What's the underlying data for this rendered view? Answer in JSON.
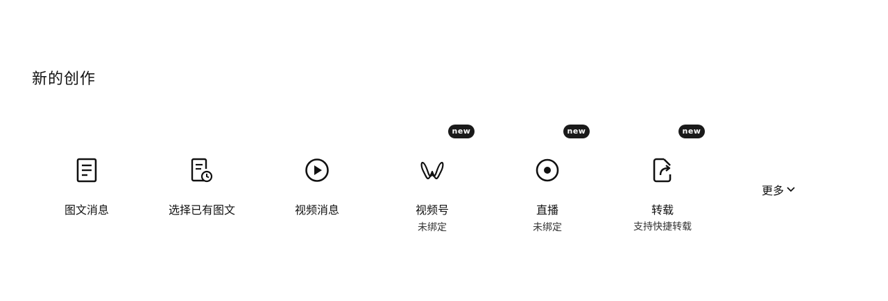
{
  "section": {
    "title": "新的创作"
  },
  "items": [
    {
      "label": "图文消息",
      "sub": "",
      "badge": "",
      "icon": "document-icon"
    },
    {
      "label": "选择已有图文",
      "sub": "",
      "badge": "",
      "icon": "document-clock-icon"
    },
    {
      "label": "视频消息",
      "sub": "",
      "badge": "",
      "icon": "play-circle-icon"
    },
    {
      "label": "视频号",
      "sub": "未绑定",
      "badge": "new",
      "icon": "channels-icon"
    },
    {
      "label": "直播",
      "sub": "未绑定",
      "badge": "new",
      "icon": "live-icon"
    },
    {
      "label": "转载",
      "sub": "支持快捷转载",
      "badge": "new",
      "icon": "repost-icon"
    }
  ],
  "more": {
    "label": "更多",
    "icon": "chevron-down-icon"
  }
}
